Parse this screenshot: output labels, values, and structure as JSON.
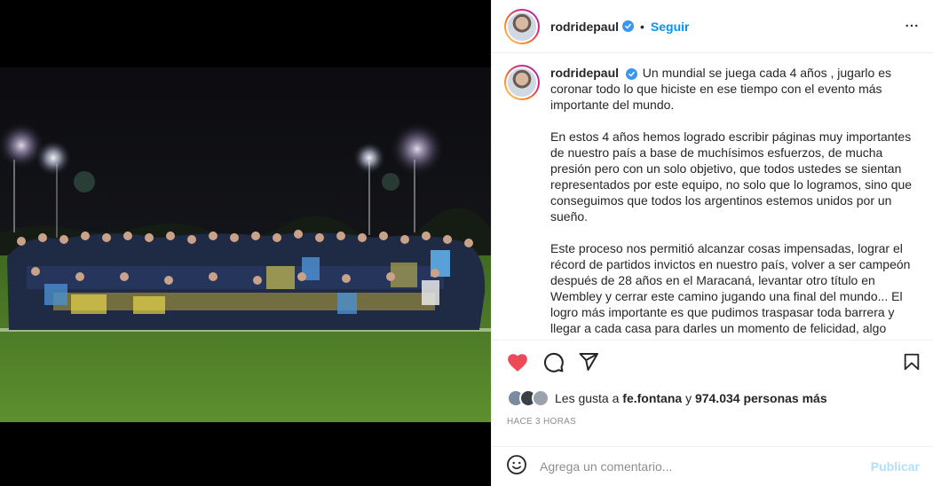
{
  "post": {
    "username": "rodridepaul",
    "separator": "•",
    "follow_label": "Seguir",
    "caption_paragraphs": [
      "Un mundial se juega cada 4 años , jugarlo es coronar todo lo que hiciste en ese tiempo con el evento más importante del mundo.",
      "En estos 4 años hemos logrado escribir páginas muy importantes de nuestro país a base de muchísimos esfuerzos, de mucha presión pero con un solo objetivo, que todos ustedes se sientan representados por este equipo, no solo que lo logramos, sino que conseguimos que todos los argentinos estemos unidos por un sueño.",
      "Este proceso nos permitió alcanzar cosas impensadas, lograr el récord de partidos invictos en nuestro país, volver a ser campeón después de 28 años en el Maracaná, levantar otro título en Wembley y cerrar este camino jugando una final del mundo... El logro más importante es que pudimos traspasar toda barrera y llegar a cada casa para darles un momento de felicidad, algo"
    ],
    "likes": {
      "prefix": "Les gusta a",
      "user": "fe.fontana",
      "connector": "y",
      "count_text": "974.034 personas más"
    },
    "time_ago": "HACE 3 HORAS",
    "comment": {
      "placeholder": "Agrega un comentario...",
      "publish_label": "Publicar"
    }
  },
  "icons": {
    "like": "heart-filled-icon",
    "comment": "comment-icon",
    "share": "paper-plane-icon",
    "save": "bookmark-icon",
    "emoji": "emoji-icon",
    "more": "more-options-icon",
    "verified": "verified-badge-icon"
  },
  "colors": {
    "like_red": "#ed4956",
    "link_blue": "#0095f6",
    "publish_disabled": "#b2dffc",
    "muted_text": "#8e8e8e"
  }
}
